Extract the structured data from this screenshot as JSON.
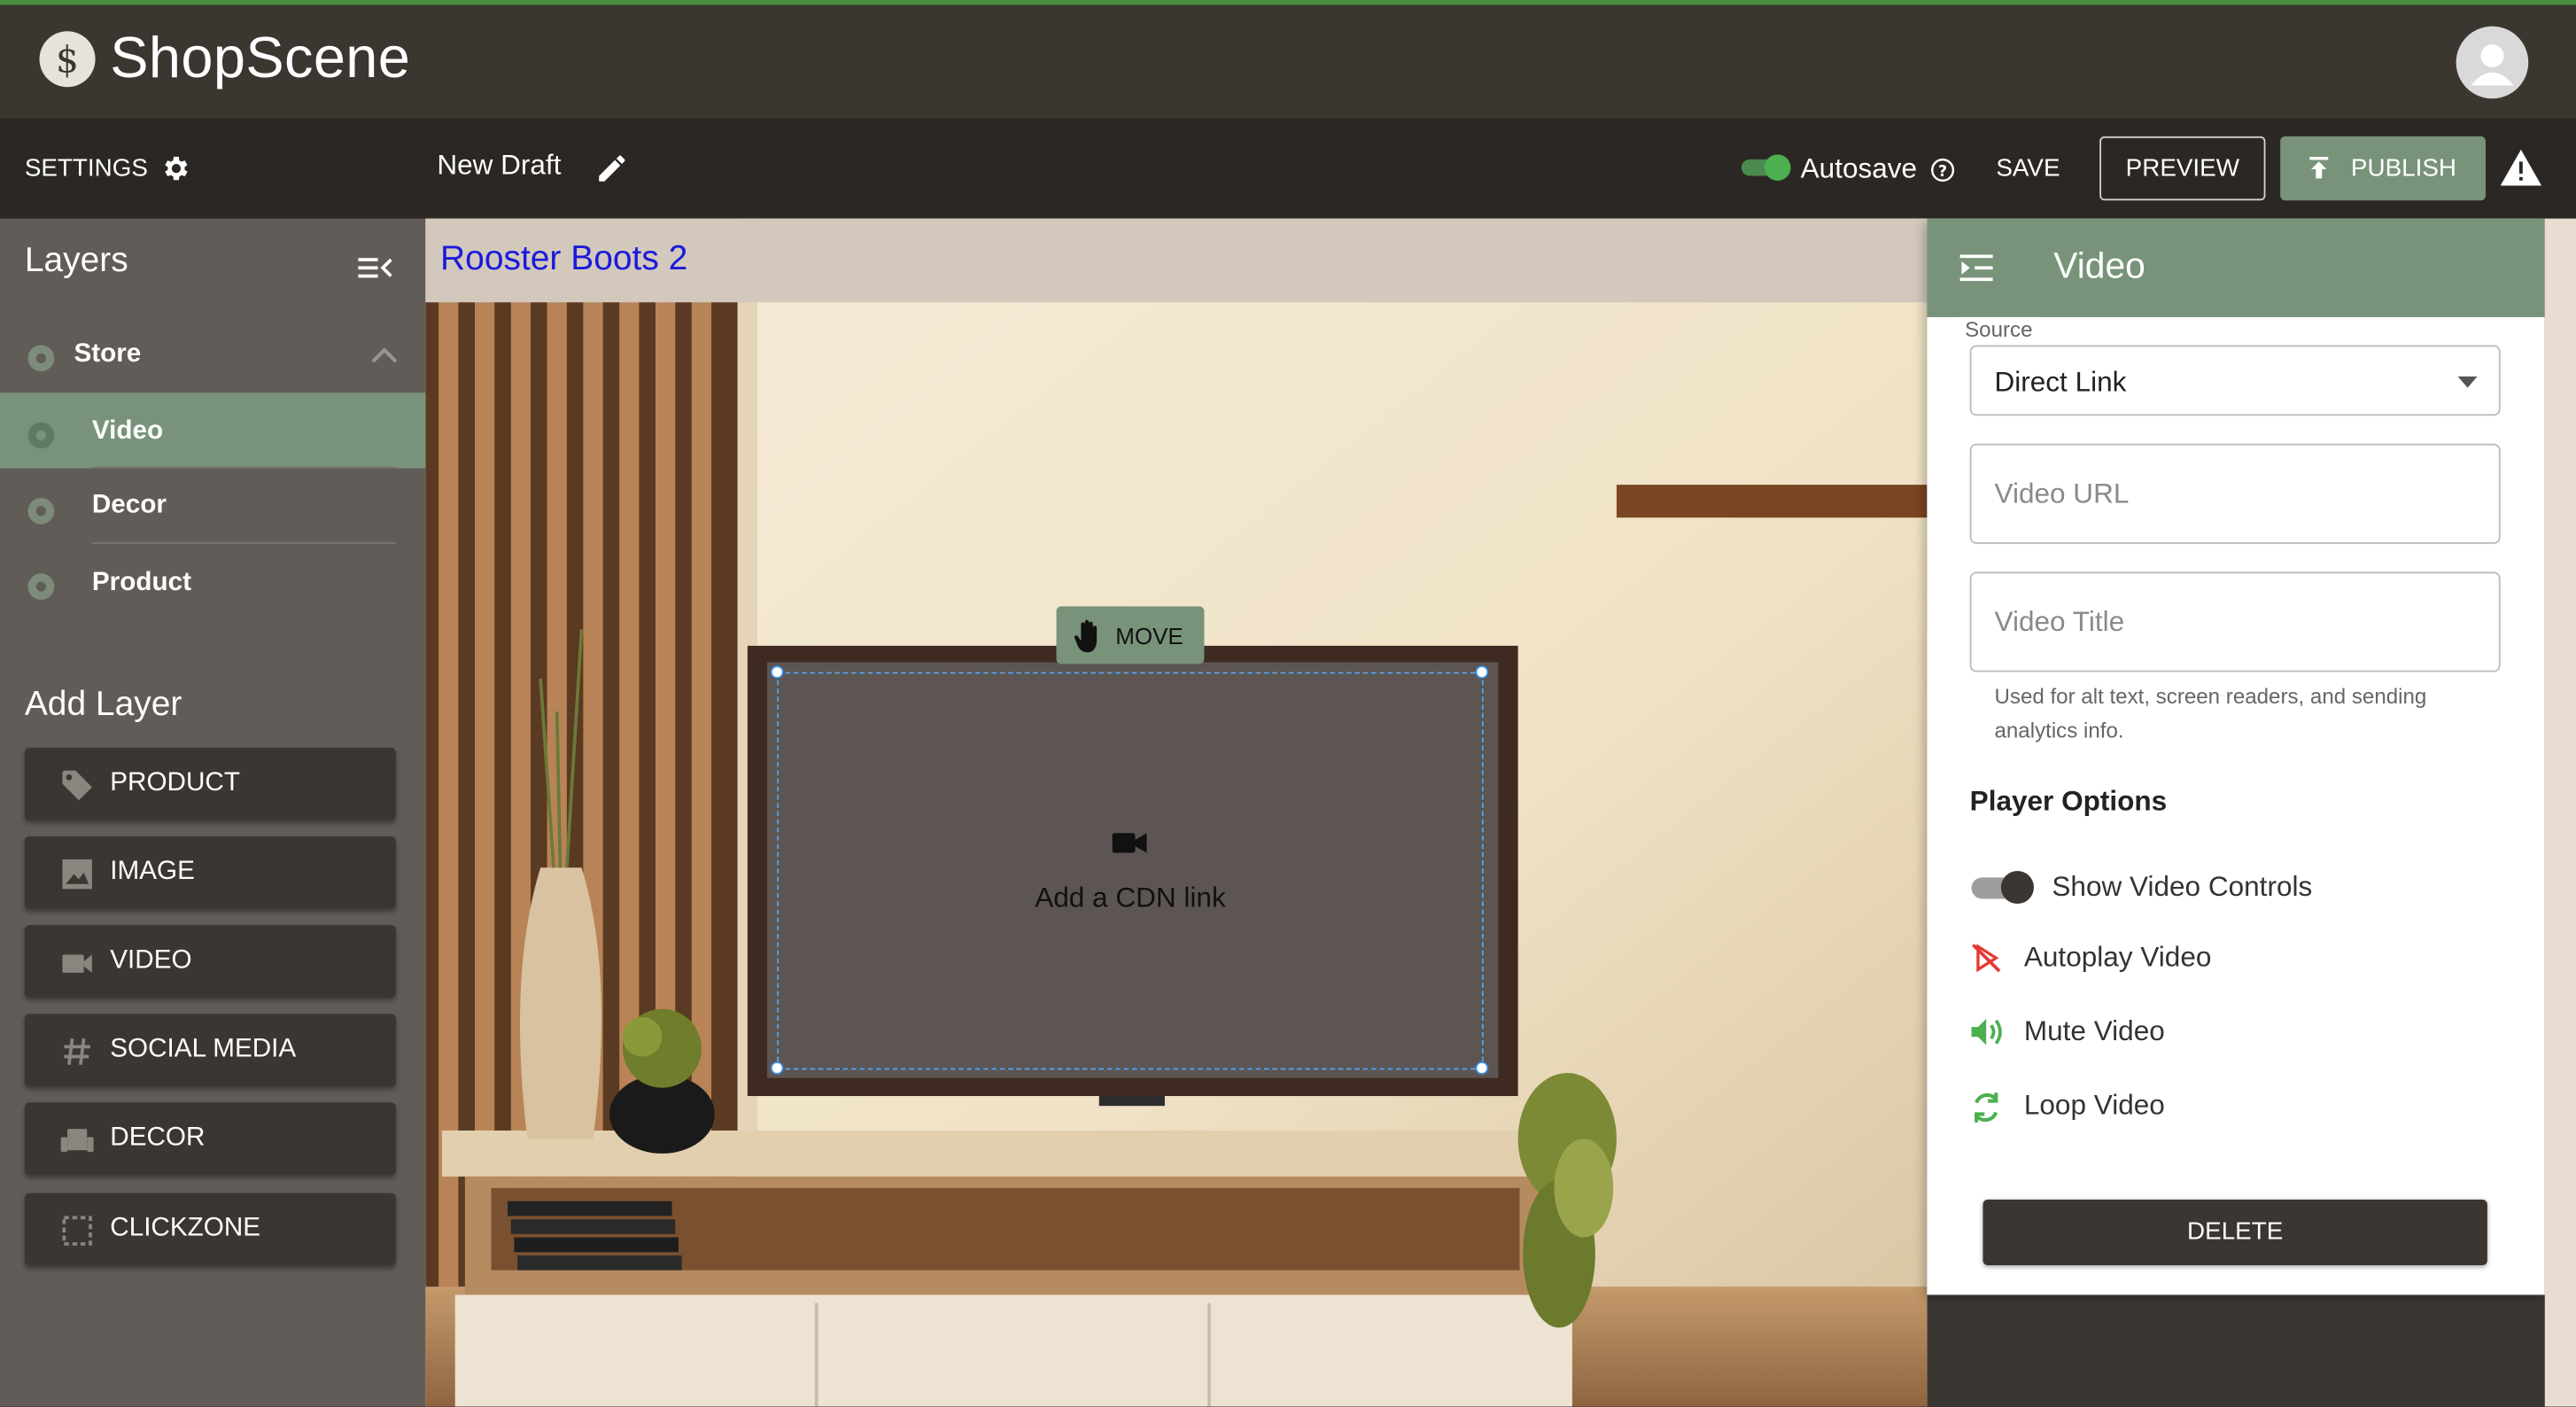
{
  "app": {
    "brand": "ShopScene"
  },
  "toolbar": {
    "settings_label": "SETTINGS",
    "draft_name": "New Draft",
    "autosave_label": "Autosave",
    "autosave_on": true,
    "save_label": "SAVE",
    "preview_label": "PREVIEW",
    "publish_label": "PUBLISH"
  },
  "sidebar": {
    "layers_title": "Layers",
    "layers": [
      {
        "label": "Store",
        "expanded": true
      },
      {
        "label": "Video",
        "selected": true
      },
      {
        "label": "Decor"
      },
      {
        "label": "Product"
      }
    ],
    "add_layer_title": "Add Layer",
    "add_buttons": [
      {
        "label": "PRODUCT",
        "icon": "tag-icon"
      },
      {
        "label": "IMAGE",
        "icon": "image-icon"
      },
      {
        "label": "VIDEO",
        "icon": "videocam-icon"
      },
      {
        "label": "SOCIAL MEDIA",
        "icon": "hashtag-icon"
      },
      {
        "label": "DECOR",
        "icon": "sofa-icon"
      },
      {
        "label": "CLICKZONE",
        "icon": "dashed-square-icon"
      }
    ]
  },
  "canvas": {
    "scene_title": "Rooster Boots 2",
    "move_label": "MOVE",
    "placeholder_text": "Add a CDN link"
  },
  "panel": {
    "title": "Video",
    "source_label": "Source",
    "source_value": "Direct Link",
    "video_url_placeholder": "Video URL",
    "video_title_placeholder": "Video Title",
    "helper_text": "Used for alt text, screen readers, and sending analytics info.",
    "player_options_title": "Player Options",
    "options": {
      "show_controls": "Show Video Controls",
      "autoplay": "Autoplay Video",
      "mute": "Mute Video",
      "loop": "Loop Video"
    },
    "delete_label": "DELETE"
  },
  "colors": {
    "accent_green": "#78937a",
    "toggle_green": "#4caf50",
    "dark": "#3b3632",
    "link_blue": "#1a1adb",
    "autoplay_red": "#e53935"
  }
}
